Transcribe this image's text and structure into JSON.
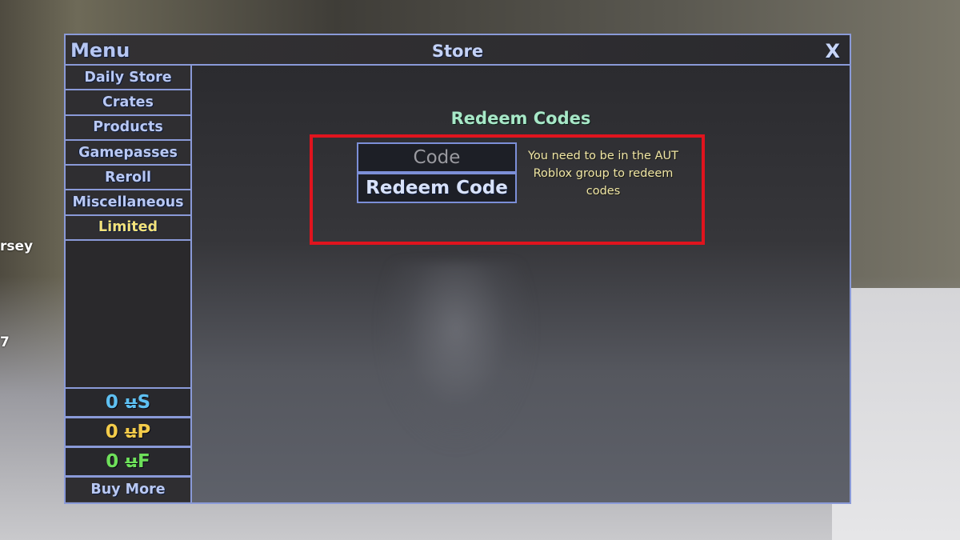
{
  "background": {
    "side_texts": [
      "rsey",
      "7"
    ]
  },
  "window": {
    "menu_label": "Menu",
    "title": "Store",
    "close_label": "X"
  },
  "sidebar": {
    "items": [
      {
        "label": "Daily Store"
      },
      {
        "label": "Crates"
      },
      {
        "label": "Products"
      },
      {
        "label": "Gamepasses"
      },
      {
        "label": "Reroll"
      },
      {
        "label": "Miscellaneous"
      },
      {
        "label": "Limited",
        "highlight_color": "#f3e27a"
      }
    ],
    "currencies": [
      {
        "amount": "0",
        "symbol": "u",
        "suffix": "S",
        "color": "#5ec0f2"
      },
      {
        "amount": "0",
        "symbol": "u",
        "suffix": "P",
        "color": "#f4cc4a"
      },
      {
        "amount": "0",
        "symbol": "u",
        "suffix": "F",
        "color": "#6ee05a"
      }
    ],
    "buy_more_label": "Buy More"
  },
  "content": {
    "section_title": "Redeem Codes",
    "code_input": {
      "value": "",
      "placeholder": "Code"
    },
    "redeem_button_label": "Redeem Code",
    "notice": "You need to be in the AUT Roblox group to redeem codes",
    "highlight_color": "#e0141e"
  }
}
